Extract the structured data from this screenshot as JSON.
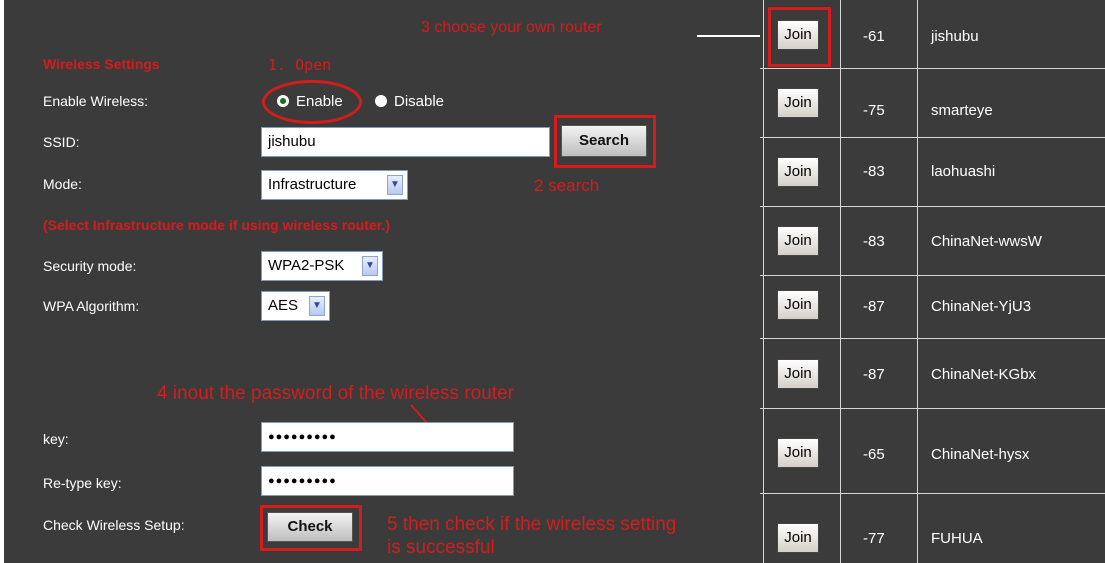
{
  "form": {
    "section_title": "Wireless Settings",
    "enable_wireless_label": "Enable Wireless:",
    "enable_option": "Enable",
    "disable_option": "Disable",
    "ssid_label": "SSID:",
    "ssid_value": "jishubu",
    "search_button": "Search",
    "mode_label": "Mode:",
    "mode_value": "Infrastructure",
    "mode_hint": "(Select Infrastructure mode if using wireless router.)",
    "security_label": "Security mode:",
    "security_value": "WPA2-PSK",
    "algorithm_label": "WPA Algorithm:",
    "algorithm_value": "AES",
    "key_label": "key:",
    "key_value": "●●●●●●●●●",
    "retype_label": "Re-type key:",
    "retype_value": "●●●●●●●●●",
    "check_label": "Check  Wireless Setup:",
    "check_button": "Check"
  },
  "annotations": {
    "step1": "1. Open",
    "step2": "2 search",
    "step3": "3 choose your own router",
    "step4": "4 inout the password of the wireless router",
    "step5_line1": "5 then check if the wireless setting",
    "step5_line2": "is successful"
  },
  "networks": {
    "join_label": "Join",
    "rows": [
      {
        "signal": "-61",
        "ssid": "jishubu"
      },
      {
        "signal": "-75",
        "ssid": "smarteye"
      },
      {
        "signal": "-83",
        "ssid": "laohuashi"
      },
      {
        "signal": "-83",
        "ssid": "ChinaNet-wwsW"
      },
      {
        "signal": "-87",
        "ssid": "ChinaNet-YjU3"
      },
      {
        "signal": "-87",
        "ssid": "ChinaNet-KGbx"
      },
      {
        "signal": "-65",
        "ssid": "ChinaNet-hysx"
      },
      {
        "signal": "-77",
        "ssid": "FUHUA"
      }
    ]
  },
  "colors": {
    "panel_bg": "#3b3b3b",
    "annotation_red": "#d41c1c",
    "text": "#ffffff"
  }
}
